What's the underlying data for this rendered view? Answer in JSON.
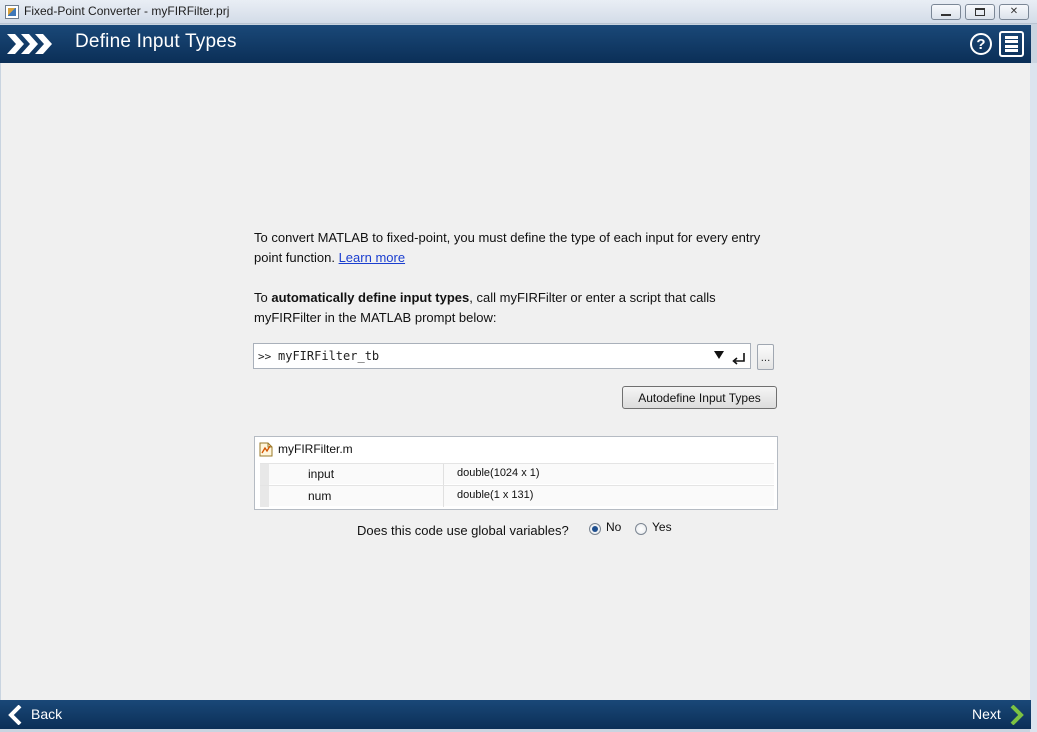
{
  "window": {
    "title": "Fixed-Point Converter - myFIRFilter.prj",
    "close_label": "✕"
  },
  "header": {
    "title": "Define Input Types",
    "help_label": "?"
  },
  "intro": {
    "text": "To convert MATLAB to fixed-point, you must define the type of each input for every entry point function.",
    "learn_more": "Learn more"
  },
  "instruction": {
    "prefix": "To ",
    "bold": "automatically define input types",
    "suffix": ", call myFIRFilter or enter a script that calls myFIRFilter in the MATLAB prompt below:"
  },
  "prompt": {
    "prefix": ">>",
    "value": "myFIRFilter_tb",
    "browse_label": "..."
  },
  "autodefine_button": "Autodefine Input Types",
  "function": {
    "file_name": "myFIRFilter.m",
    "inputs": [
      {
        "name": "input",
        "type": "double(1024 x 1)"
      },
      {
        "name": "num",
        "type": "double(1 x 131)"
      }
    ]
  },
  "globals": {
    "question": "Does this code use global variables?",
    "options": [
      "No",
      "Yes"
    ],
    "selected": "No"
  },
  "footer": {
    "back_label": "Back",
    "next_label": "Next"
  },
  "colors": {
    "header_bg": "#0b2f57",
    "accent_green": "#7cc242",
    "link": "#1a3ecf"
  }
}
